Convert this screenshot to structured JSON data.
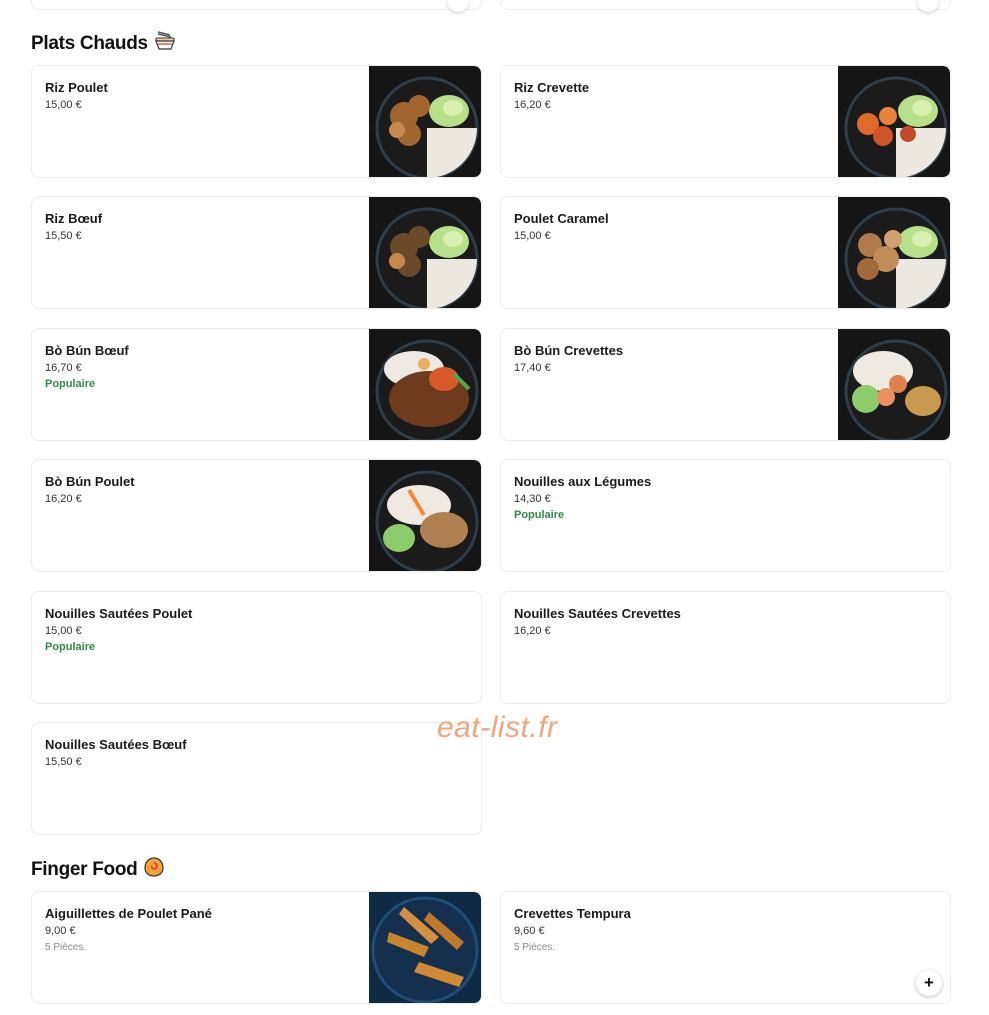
{
  "sections": [
    {
      "title": "Plats Chauds",
      "emoji_icon": "noodle-bowl-icon",
      "items": [
        {
          "name": "Riz Poulet",
          "price": "15,00 €",
          "image": "rice-chicken"
        },
        {
          "name": "Riz Crevette",
          "price": "16,20 €",
          "image": "rice-shrimp"
        },
        {
          "name": "Riz Bœuf",
          "price": "15,50 €",
          "image": "rice-beef"
        },
        {
          "name": "Poulet Caramel",
          "price": "15,00 €",
          "image": "caramel-chicken"
        },
        {
          "name": "Bò Bún Bœuf",
          "price": "16,70 €",
          "tag": "Populaire",
          "image": "bobun-beef"
        },
        {
          "name": "Bò Bún Crevettes",
          "price": "17,40 €",
          "image": "bobun-shrimp"
        },
        {
          "name": "Bò Bún Poulet",
          "price": "16,20 €",
          "image": "bobun-chicken"
        },
        {
          "name": "Nouilles aux Légumes",
          "price": "14,30 €",
          "tag": "Populaire"
        },
        {
          "name": "Nouilles Sautées Poulet",
          "price": "15,00 €",
          "tag": "Populaire"
        },
        {
          "name": "Nouilles Sautées Crevettes",
          "price": "16,20 €"
        },
        {
          "name": "Nouilles Sautées Bœuf",
          "price": "15,50 €"
        }
      ]
    },
    {
      "title": "Finger Food",
      "emoji_icon": "fish-cake-icon",
      "items": [
        {
          "name": "Aiguillettes de Poulet Pané",
          "price": "9,00 €",
          "desc": "5 Pièces.",
          "image": "breaded-chicken"
        },
        {
          "name": "Crevettes Tempura",
          "price": "9,60 €",
          "desc": "5 Pièces.",
          "add_label": "+"
        }
      ]
    }
  ],
  "watermark": "eat-list.fr",
  "colors": {
    "popular_tag": "#2f8a4a",
    "watermark": "#f0a57c",
    "border": "#ececec"
  }
}
